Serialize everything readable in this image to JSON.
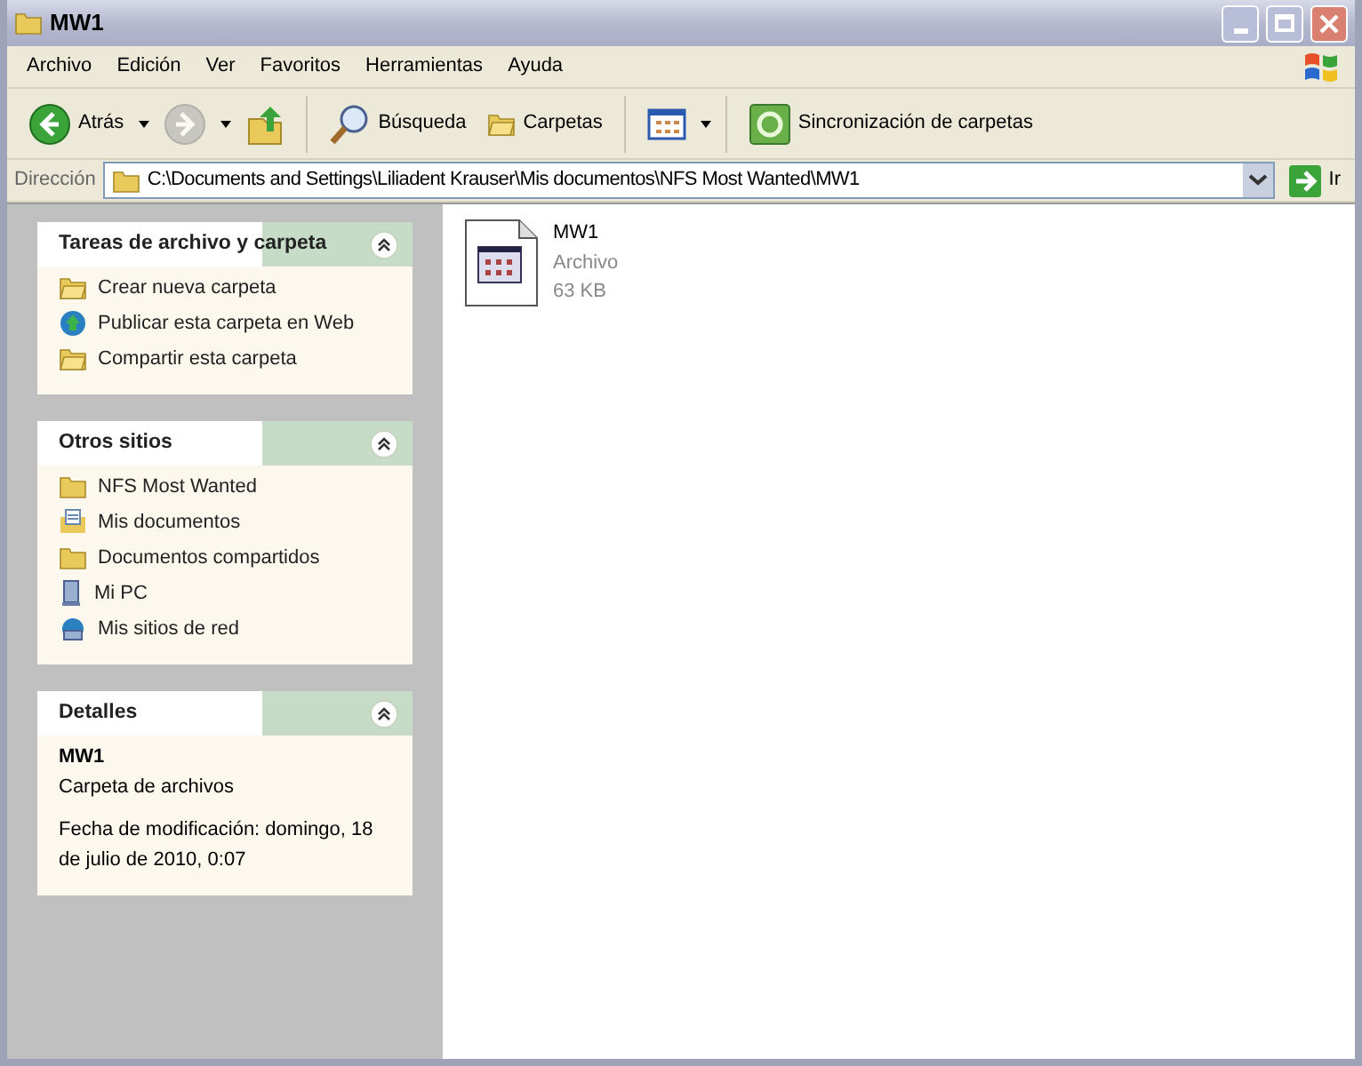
{
  "window": {
    "title": "MW1"
  },
  "menu": [
    "Archivo",
    "Edición",
    "Ver",
    "Favoritos",
    "Herramientas",
    "Ayuda"
  ],
  "toolbar": [
    {
      "kind": "back",
      "label": "Atrás",
      "disabled": false,
      "dropdown": true
    },
    {
      "kind": "forward",
      "disabled": true,
      "dropdown": true
    },
    {
      "kind": "up",
      "disabled": false,
      "dropdown": false
    },
    {
      "kind": "sep"
    },
    {
      "kind": "search",
      "label": "Búsqueda",
      "disabled": false,
      "dropdown": false
    },
    {
      "kind": "folders",
      "label": "Carpetas",
      "disabled": false,
      "dropdown": false
    },
    {
      "kind": "sep"
    },
    {
      "kind": "views",
      "disabled": false,
      "dropdown": true
    },
    {
      "kind": "sep"
    },
    {
      "kind": "sync",
      "label": "Sincronización de carpetas",
      "disabled": false,
      "dropdown": false
    }
  ],
  "address": {
    "label": "Dirección",
    "value": "C:\\Documents and Settings\\Liliadent Krauser\\Mis documentos\\NFS Most Wanted\\MW1",
    "go": "Ir"
  },
  "panels": [
    {
      "kind": "links",
      "title": "Tareas de archivo y carpeta",
      "expanded": true,
      "items": [
        {
          "kind": "newfolder",
          "label": "Crear nueva carpeta"
        },
        {
          "kind": "globe",
          "label": "Publicar esta carpeta en Web"
        },
        {
          "kind": "share",
          "label": "Compartir esta carpeta"
        }
      ]
    },
    {
      "kind": "links",
      "title": "Otros sitios",
      "expanded": true,
      "items": [
        {
          "kind": "folder",
          "label": "NFS Most Wanted"
        },
        {
          "kind": "docs",
          "label": "Mis documentos"
        },
        {
          "kind": "folder",
          "label": "Documentos compartidos"
        },
        {
          "kind": "pc",
          "label": "Mi PC"
        },
        {
          "kind": "network",
          "label": "Mis sitios de red"
        }
      ]
    },
    {
      "kind": "details",
      "title": "Detalles",
      "expanded": true,
      "name": "MW1",
      "type": "Carpeta de archivos",
      "modified": "Fecha de modificación: domingo, 18 de julio de 2010, 0:07"
    }
  ],
  "files": [
    {
      "name": "MW1",
      "type": "Archivo",
      "size": "63 KB",
      "selected": false
    }
  ]
}
